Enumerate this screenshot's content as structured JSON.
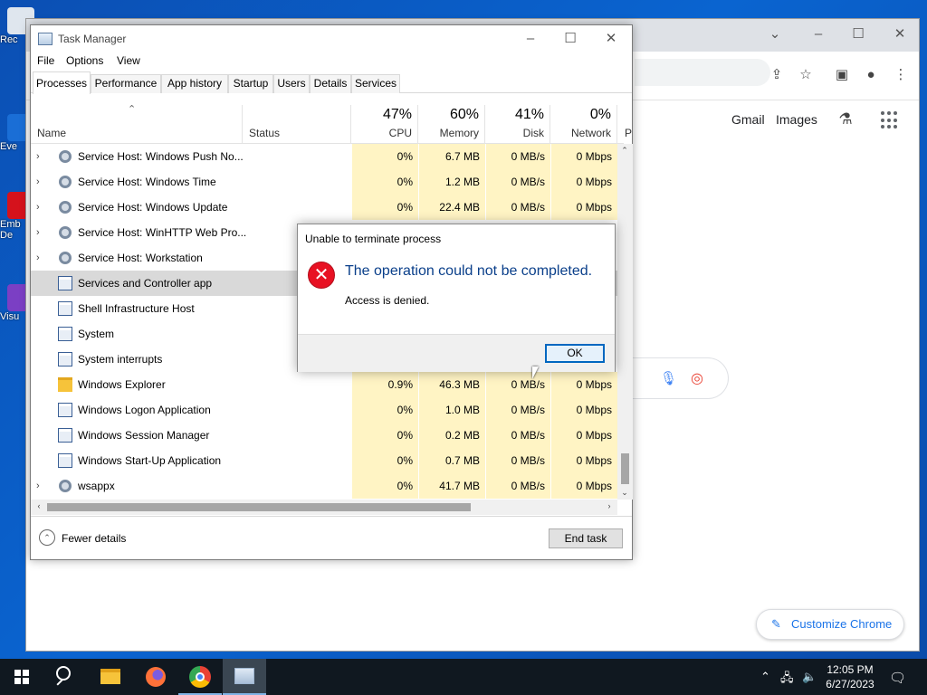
{
  "desktop": {
    "icons": [
      {
        "label": "Rec",
        "color": "#dfe6ee"
      },
      {
        "label": "Eve",
        "color": "#1a6ed6"
      },
      {
        "label": "Emb De",
        "color": "#d5121c"
      },
      {
        "label": "Visu",
        "color": "#7b3fc4"
      }
    ]
  },
  "chrome": {
    "links": {
      "gmail": "Gmail",
      "images": "Images"
    },
    "customize_label": "Customize Chrome"
  },
  "task_manager": {
    "title": "Task Manager",
    "menu": [
      "File",
      "Options",
      "View"
    ],
    "tabs": [
      "Processes",
      "Performance",
      "App history",
      "Startup",
      "Users",
      "Details",
      "Services"
    ],
    "active_tab": "Processes",
    "columns": {
      "name": "Name",
      "status": "Status",
      "cpu": {
        "pct": "47%",
        "label": "CPU"
      },
      "memory": {
        "pct": "60%",
        "label": "Memory"
      },
      "disk": {
        "pct": "41%",
        "label": "Disk"
      },
      "network": {
        "pct": "0%",
        "label": "Network"
      },
      "extra": "P"
    },
    "rows": [
      {
        "name": "Service Host: Windows Push No...",
        "cpu": "0%",
        "memory": "6.7 MB",
        "disk": "0 MB/s",
        "network": "0 Mbps",
        "icon": "gear-icon",
        "expandable": true
      },
      {
        "name": "Service Host: Windows Time",
        "cpu": "0%",
        "memory": "1.2 MB",
        "disk": "0 MB/s",
        "network": "0 Mbps",
        "icon": "gear-icon",
        "expandable": true
      },
      {
        "name": "Service Host: Windows Update",
        "cpu": "0%",
        "memory": "22.4 MB",
        "disk": "0 MB/s",
        "network": "0 Mbps",
        "icon": "gear-icon",
        "expandable": true
      },
      {
        "name": "Service Host: WinHTTP Web Pro...",
        "cpu": "",
        "memory": "",
        "disk": "",
        "network": "",
        "icon": "gear-icon",
        "expandable": true
      },
      {
        "name": "Service Host: Workstation",
        "cpu": "",
        "memory": "",
        "disk": "",
        "network": "",
        "icon": "gear-icon",
        "expandable": true
      },
      {
        "name": "Services and Controller app",
        "cpu": "",
        "memory": "",
        "disk": "",
        "network": "",
        "icon": "window-icon",
        "expandable": false,
        "selected": true
      },
      {
        "name": "Shell Infrastructure Host",
        "cpu": "",
        "memory": "",
        "disk": "",
        "network": "",
        "icon": "window-icon",
        "expandable": false
      },
      {
        "name": "System",
        "cpu": "",
        "memory": "",
        "disk": "",
        "network": "",
        "icon": "window-icon",
        "expandable": false
      },
      {
        "name": "System interrupts",
        "cpu": "",
        "memory": "",
        "disk": "",
        "network": "",
        "icon": "window-icon",
        "expandable": false
      },
      {
        "name": "Windows Explorer",
        "cpu": "0.9%",
        "memory": "46.3 MB",
        "disk": "0 MB/s",
        "network": "0 Mbps",
        "icon": "folder-icon",
        "expandable": false
      },
      {
        "name": "Windows Logon Application",
        "cpu": "0%",
        "memory": "1.0 MB",
        "disk": "0 MB/s",
        "network": "0 Mbps",
        "icon": "window-icon",
        "expandable": false
      },
      {
        "name": "Windows Session Manager",
        "cpu": "0%",
        "memory": "0.2 MB",
        "disk": "0 MB/s",
        "network": "0 Mbps",
        "icon": "window-icon",
        "expandable": false
      },
      {
        "name": "Windows Start-Up Application",
        "cpu": "0%",
        "memory": "0.7 MB",
        "disk": "0 MB/s",
        "network": "0 Mbps",
        "icon": "window-icon",
        "expandable": false
      },
      {
        "name": "wsappx",
        "cpu": "0%",
        "memory": "41.7 MB",
        "disk": "0 MB/s",
        "network": "0 Mbps",
        "icon": "gear-icon",
        "expandable": true
      }
    ],
    "fewer_details": "Fewer details",
    "end_task": "End task"
  },
  "dialog": {
    "title": "Unable to terminate process",
    "main_instruction": "The operation could not be completed.",
    "content": "Access is denied.",
    "ok_label": "OK"
  },
  "taskbar": {
    "time": "12:05 PM",
    "date": "6/27/2023"
  },
  "colors": {
    "accent": "#0067c0",
    "error": "#e81123",
    "heat": "#fff4c4"
  }
}
